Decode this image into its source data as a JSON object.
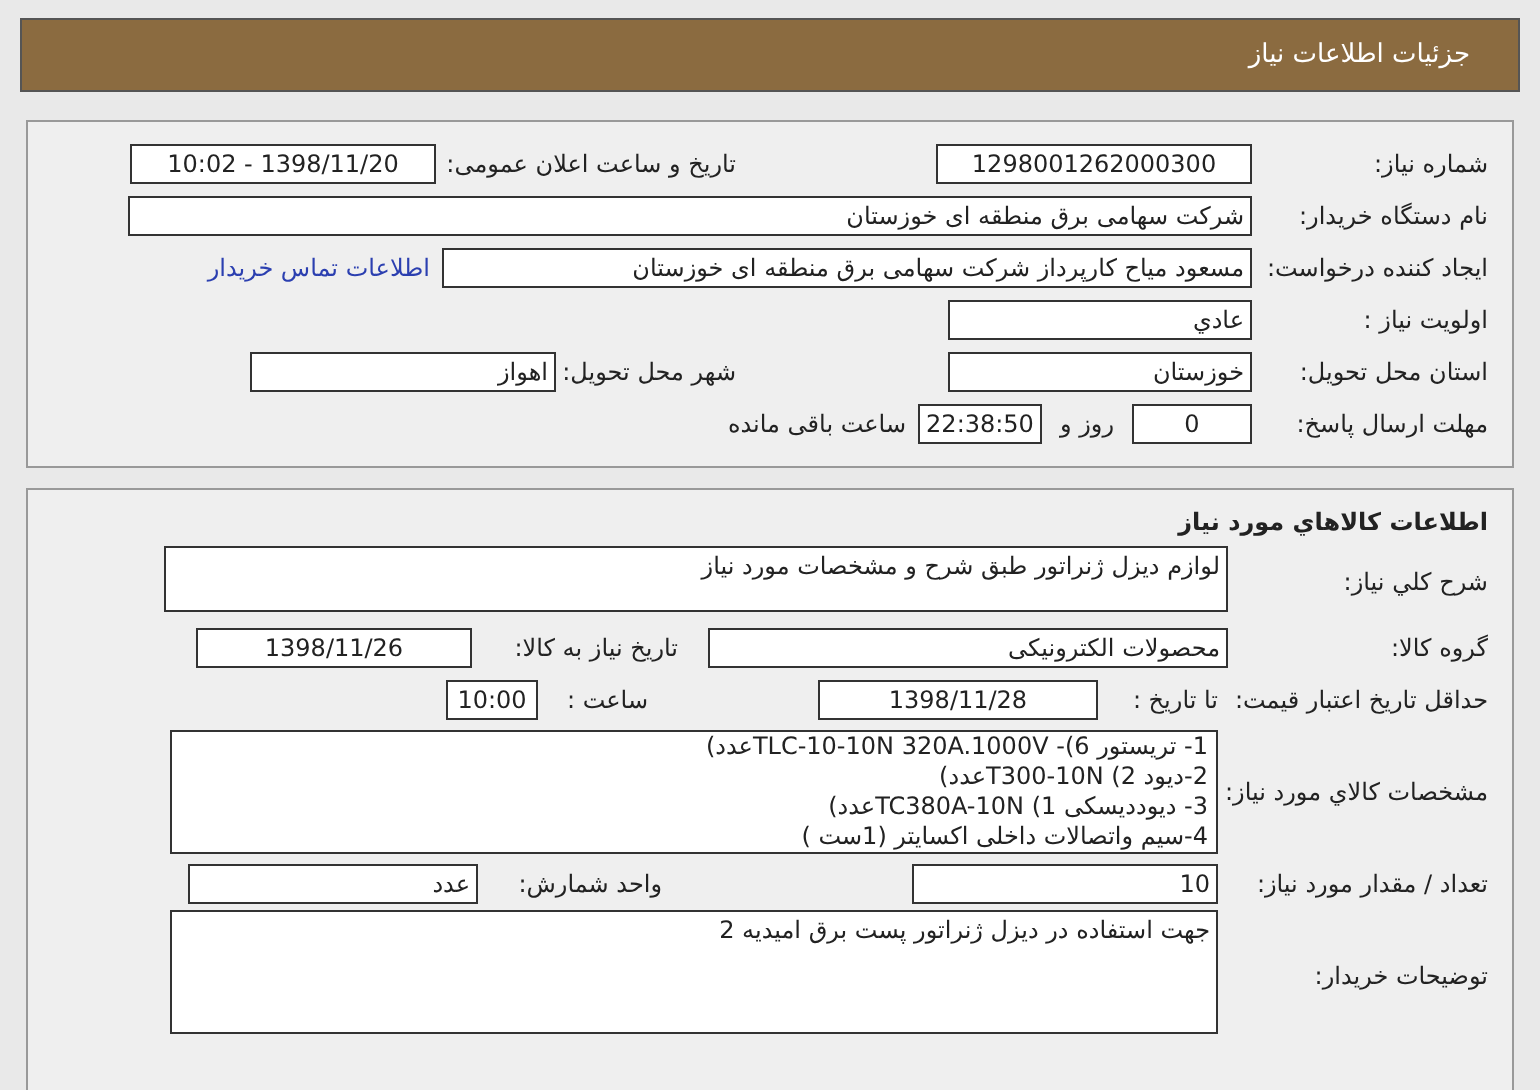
{
  "header": {
    "title": "جزئیات اطلاعات نیاز"
  },
  "need_info": {
    "need_number": {
      "label": "شماره نیاز:",
      "value": "1298001262000300"
    },
    "announce_datetime": {
      "label": "تاریخ و ساعت اعلان عمومی:",
      "value": "1398/11/20 - 10:02"
    },
    "buyer_org": {
      "label": "نام دستگاه خریدار:",
      "value": "شرکت سهامی برق منطقه ای خوزستان"
    },
    "requester": {
      "label": "ایجاد کننده درخواست:",
      "value": "مسعود میاح کارپرداز شرکت سهامی برق منطقه ای خوزستان"
    },
    "contact_link": "اطلاعات تماس خریدار",
    "priority": {
      "label": "اولویت نیاز :",
      "value": "عادي"
    },
    "delivery_province": {
      "label": "استان محل تحویل:",
      "value": "خوزستان"
    },
    "delivery_city": {
      "label": "شهر محل تحویل:",
      "value": "اهواز"
    },
    "response_deadline": {
      "label": "مهلت ارسال پاسخ:",
      "days": "0",
      "days_unit": "روز و",
      "time": "22:38:50",
      "time_suffix": "ساعت باقی مانده"
    }
  },
  "goods_info": {
    "title": "اطلاعات کالاهاي مورد نياز",
    "general_description": {
      "label": "شرح کلي نياز:",
      "value": "لوازم دیزل ژنراتور طبق شرح و مشخصات مورد نیاز"
    },
    "goods_group": {
      "label": "گروه کالا:",
      "value": "محصولات الکترونیکی"
    },
    "need_date": {
      "label": "تاریخ نیاز به کالا:",
      "value": "1398/11/26"
    },
    "price_validity": {
      "label": "حداقل تاریخ اعتبار قیمت:",
      "date_label": "تا تاریخ :",
      "date": "1398/11/28",
      "time_label": "ساعت :",
      "time": "10:00"
    },
    "specs": {
      "label": "مشخصات کالاي مورد نياز:",
      "lines": [
        "1- تریستور 6)- TLC-10-10N  320A.1000Vعدد)",
        "2-دیود 2) T300-10Nعدد)",
        "3- دیوددیسکی  1) TC380A-10Nعدد)",
        "4-سیم واتصالات داخلی اکسایتر  (1ست )"
      ]
    },
    "quantity": {
      "label": "تعداد / مقدار مورد نیاز:",
      "value": "10"
    },
    "unit": {
      "label": "واحد شمارش:",
      "value": "عدد"
    },
    "buyer_notes": {
      "label": "توضیحات خریدار:",
      "value": "جهت استفاده در دیزل ژنراتور پست برق امیدیه 2"
    }
  }
}
